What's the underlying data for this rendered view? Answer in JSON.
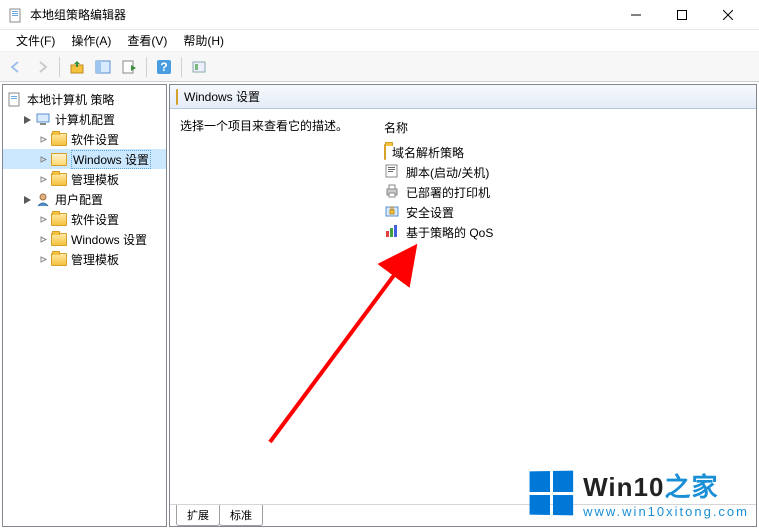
{
  "titlebar": {
    "title": "本地组策略编辑器"
  },
  "menubar": {
    "file": "文件(F)",
    "action": "操作(A)",
    "view": "查看(V)",
    "help": "帮助(H)"
  },
  "tree": {
    "root": "本地计算机 策略",
    "computer_config": "计算机配置",
    "computer_software": "软件设置",
    "computer_windows": "Windows 设置",
    "computer_templates": "管理模板",
    "user_config": "用户配置",
    "user_software": "软件设置",
    "user_windows": "Windows 设置",
    "user_templates": "管理模板"
  },
  "content": {
    "header": "Windows 设置",
    "description": "选择一个项目来查看它的描述。",
    "name_header": "名称",
    "items": [
      {
        "label": "域名解析策略",
        "icon": "folder"
      },
      {
        "label": "脚本(启动/关机)",
        "icon": "script"
      },
      {
        "label": "已部署的打印机",
        "icon": "printer"
      },
      {
        "label": "安全设置",
        "icon": "security"
      },
      {
        "label": "基于策略的 QoS",
        "icon": "qos"
      }
    ]
  },
  "tabs": {
    "extended": "扩展",
    "standard": "标准"
  },
  "watermark": {
    "brand": "Win10",
    "suffix": "之家",
    "url": "www.win10xitong.com"
  }
}
